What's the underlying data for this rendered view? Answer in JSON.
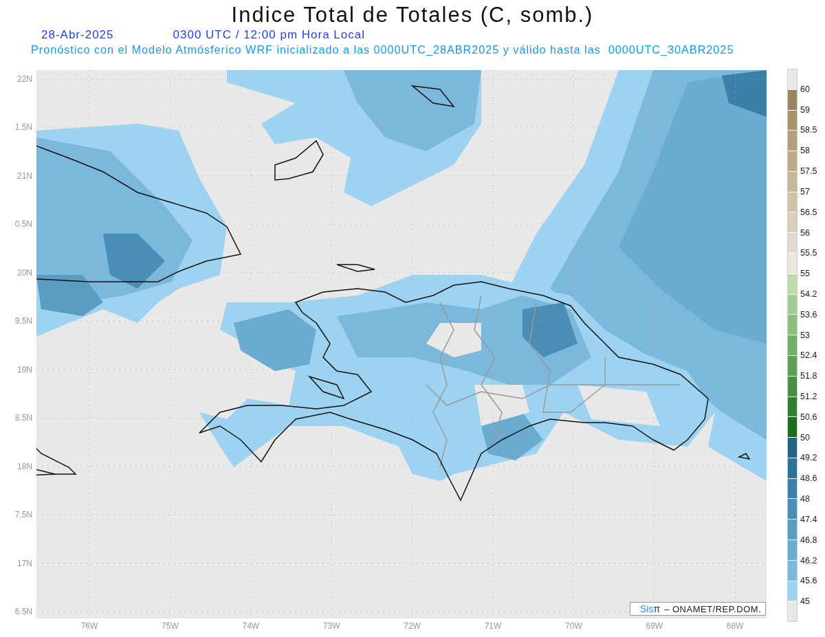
{
  "title": "Indice Total de Totales (C, somb.)",
  "date": "28-Abr-2025",
  "time": "0300 UTC / 12:00 pm Hora Local",
  "description": "Pronóstico con el Modelo Atmósferico WRF inicializado a las 0000UTC_28ABR2025 y válido hasta las  0000UTC_30ABR2025",
  "map": {
    "lat_labels": [
      "22N",
      "1.5N",
      "21N",
      "0.5N",
      "20N",
      "9.5N",
      "19N",
      "8.5N",
      "18N",
      "7.5N",
      "17N",
      "6.5N"
    ],
    "lon_labels": [
      "76W",
      "75W",
      "74W",
      "73W",
      "72W",
      "71W",
      "70W",
      "69W",
      "68W"
    ]
  },
  "legend": {
    "bins": [
      {
        "color": "#e8e8e8"
      },
      {
        "color": "#9a8560"
      },
      {
        "color": "#a8946c"
      },
      {
        "color": "#b19f7c"
      },
      {
        "color": "#bcab8a"
      },
      {
        "color": "#c6b79a"
      },
      {
        "color": "#d0c3ab"
      },
      {
        "color": "#dacfbd"
      },
      {
        "color": "#e2dace"
      },
      {
        "color": "#ebe6df"
      },
      {
        "color": "#bddbb0"
      },
      {
        "color": "#a3cc96"
      },
      {
        "color": "#8cbf7e"
      },
      {
        "color": "#75ad6a"
      },
      {
        "color": "#5f9e57"
      },
      {
        "color": "#4a8e44"
      },
      {
        "color": "#347f32"
      },
      {
        "color": "#1f6d1f"
      },
      {
        "color": "#216487"
      },
      {
        "color": "#2e7298"
      },
      {
        "color": "#3a80a8"
      },
      {
        "color": "#4a8db5"
      },
      {
        "color": "#5a9cc2"
      },
      {
        "color": "#6aabcf"
      },
      {
        "color": "#7bb8dc"
      },
      {
        "color": "#9dd3f0"
      },
      {
        "color": "#e8e8e8"
      }
    ],
    "labels": [
      "60",
      "59",
      "58.5",
      "58",
      "57.5",
      "57",
      "56.5",
      "56",
      "55.5",
      "55",
      "54.2",
      "53.6",
      "53",
      "52.4",
      "51.8",
      "51.2",
      "50.6",
      "50",
      "49.2",
      "48.6",
      "48",
      "47.4",
      "46.8",
      "46.2",
      "45.6",
      "45"
    ]
  },
  "credit": {
    "logo": "Sis",
    "logo_mark": "π",
    "text": "– ONAMET/REP.DOM."
  }
}
